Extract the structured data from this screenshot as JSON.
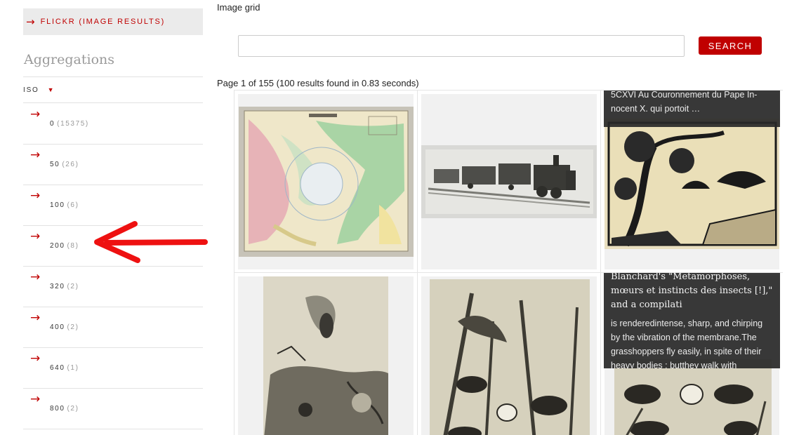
{
  "page": {
    "title": "Image grid"
  },
  "sidebar": {
    "source_label": "FLICKR (IMAGE RESULTS)",
    "aggregations_title": "Aggregations",
    "facet": {
      "name": "ISO",
      "items": [
        {
          "value": "0",
          "count": "(15375)"
        },
        {
          "value": "50",
          "count": "(26)"
        },
        {
          "value": "100",
          "count": "(6)"
        },
        {
          "value": "200",
          "count": "(8)"
        },
        {
          "value": "320",
          "count": "(2)"
        },
        {
          "value": "400",
          "count": "(2)"
        },
        {
          "value": "640",
          "count": "(1)"
        },
        {
          "value": "800",
          "count": "(2)"
        }
      ]
    }
  },
  "search": {
    "value": "",
    "placeholder": "",
    "button_label": "SEARCH"
  },
  "results": {
    "info": "Page 1 of 155  (100 results found in 0.83 seconds)",
    "items": [
      {
        "overlay_title": "",
        "overlay_desc": ""
      },
      {
        "overlay_title": "",
        "overlay_desc": ""
      },
      {
        "overlay_title": "",
        "overlay_desc": "5CXVI Au Couronnement du Pape In-nocent X. qui portoit …"
      },
      {
        "overlay_title": "",
        "overlay_desc": ""
      },
      {
        "overlay_title": "",
        "overlay_desc": ""
      },
      {
        "overlay_title": "Blanchard's \"Metamorphoses, mœurs et instincts des insects [!],\" and a compilati",
        "overlay_desc": "is renderedintense, sharp, and chirping by the vibration of the membrane.The grasshoppers fly easily, in spite of their heavy bodies ; butthey walk with"
      }
    ]
  },
  "colors": {
    "accent": "#c00000",
    "annotation": "#ee1111"
  },
  "icons": {
    "arrow": "right-arrow-icon",
    "caret": "caret-down-icon"
  }
}
